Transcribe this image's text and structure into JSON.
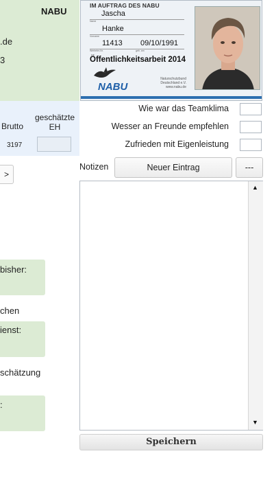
{
  "left_card": {
    "org_label": "NABU",
    "email_fragment": ".de",
    "number_fragment": "3"
  },
  "stats": {
    "brutto_header": "Brutto",
    "eh_header": "geschätzte EH",
    "brutto_value": "3197",
    "eh_value": ""
  },
  "nav": {
    "next_label": ">"
  },
  "left_fields": {
    "bisher_label": "bisher:",
    "chen_label": "chen",
    "ienst_label": "ienst:",
    "schaetzung_label": "schätzung",
    "colon_label": ":"
  },
  "id_card": {
    "header": "IM AUFTRAG DES NABU",
    "first_name": "Jascha",
    "last_name": "Hanke",
    "id_number": "11413",
    "birth_date": "09/10/1991",
    "title": "Öffentlichkeitsarbeit 2014",
    "logo_text": "NABU",
    "logo_sub": "Naturschutzbund Deutschland e.V. www.nabu.de",
    "small_vorname": "Name",
    "small_nachname": "Vorname",
    "small_nr": "Werbeler-Nr.",
    "small_geb": "geb. am"
  },
  "ratings": [
    {
      "label": "Wie war das Teamklima",
      "value": ""
    },
    {
      "label": "Wesser an Freunde empfehlen",
      "value": ""
    },
    {
      "label": "Zufrieden mit Eigenleistung",
      "value": ""
    }
  ],
  "notes": {
    "label": "Notizen",
    "new_entry_label": "Neuer Eintrag",
    "dash_label": "---",
    "text": ""
  },
  "scrollbar": {
    "up": "▲",
    "down": "▼"
  },
  "save_label": "Speichern"
}
